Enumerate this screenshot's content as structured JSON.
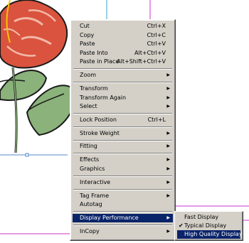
{
  "colors": {
    "menu_bg": "#d4d0c8",
    "highlight": "#0a246a",
    "guide_magenta": "#cc33cc",
    "guide_cyan": "#33aacc",
    "flower_red": "#d9533e",
    "leaf_green": "#8ab27a"
  },
  "menu": {
    "items": [
      {
        "label": "Cut",
        "shortcut": "Ctrl+X"
      },
      {
        "label": "Copy",
        "shortcut": "Ctrl+C"
      },
      {
        "label": "Paste",
        "shortcut": "Ctrl+V"
      },
      {
        "label": "Paste Into",
        "shortcut": "Alt+Ctrl+V"
      },
      {
        "label": "Paste in Place",
        "shortcut": "Alt+Shift+Ctrl+V"
      },
      {
        "label": "Zoom",
        "submenu": true
      },
      {
        "label": "Transform",
        "submenu": true
      },
      {
        "label": "Transform Again",
        "submenu": true
      },
      {
        "label": "Select",
        "submenu": true
      },
      {
        "label": "Lock Position",
        "shortcut": "Ctrl+L"
      },
      {
        "label": "Stroke Weight",
        "submenu": true
      },
      {
        "label": "Fitting",
        "submenu": true
      },
      {
        "label": "Effects",
        "submenu": true
      },
      {
        "label": "Graphics",
        "submenu": true
      },
      {
        "label": "Interactive",
        "submenu": true
      },
      {
        "label": "Tag Frame",
        "submenu": true
      },
      {
        "label": "Autotag"
      },
      {
        "label": "Display Performance",
        "submenu": true,
        "selected": true
      },
      {
        "label": "InCopy",
        "submenu": true
      }
    ],
    "arrow": "▶"
  },
  "submenu": {
    "items": [
      {
        "label": "Fast Display"
      },
      {
        "label": "Typical Display",
        "checked": true
      },
      {
        "label": "High Quality Display",
        "selected": true
      }
    ],
    "check": "✔"
  }
}
